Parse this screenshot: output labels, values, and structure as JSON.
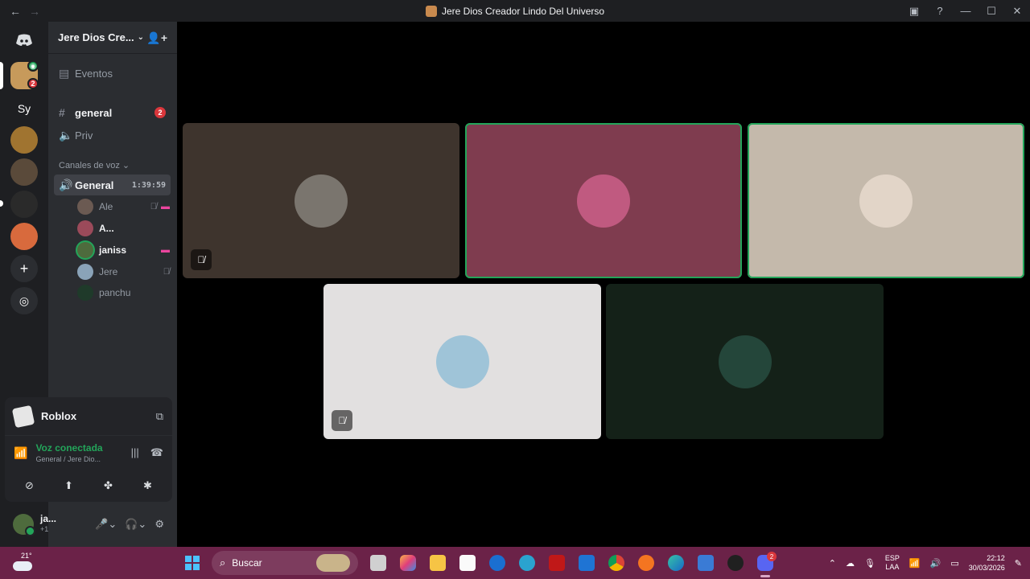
{
  "window": {
    "title": "Jere Dios Creador Lindo Del Universo"
  },
  "guild": {
    "name": "Jere Dios Cre..."
  },
  "rail": {
    "servers": [
      {
        "label": "",
        "badge": "2",
        "color": "#c79a5b"
      },
      {
        "label": "Sy",
        "badge": "",
        "color": "#2b2d31"
      },
      {
        "label": "",
        "badge": "",
        "color": "#a07430"
      },
      {
        "label": "",
        "badge": "",
        "color": "#5a4a3a"
      },
      {
        "label": "",
        "badge": "",
        "color": "#2a2a2a"
      },
      {
        "label": "",
        "badge": "",
        "color": "#d86a3d"
      }
    ]
  },
  "channels": {
    "events": "Eventos",
    "text": [
      {
        "name": "general",
        "badge": "2"
      },
      {
        "name": "Priv"
      }
    ],
    "voice_category": "Canales de voz",
    "voice": {
      "name": "General",
      "timer": "1:39:59"
    },
    "members": [
      {
        "name": "Ale",
        "muted": true,
        "streaming": true,
        "avatar_color": "#6b5a52"
      },
      {
        "name": "A...",
        "muted": false,
        "streaming": false,
        "avatar_color": "#9b4a5a"
      },
      {
        "name": "janiss",
        "muted": false,
        "streaming": true,
        "avatar_color": "#4e6b3d"
      },
      {
        "name": "Jere",
        "muted": true,
        "streaming": false,
        "avatar_color": "#8aa3b8"
      },
      {
        "name": "panchu",
        "muted": false,
        "streaming": false,
        "avatar_color": "#1f3a2a"
      }
    ]
  },
  "activity": {
    "name": "Roblox"
  },
  "voice_status": {
    "title": "Voz conectada",
    "subtitle": "General / Jere Dio..."
  },
  "user": {
    "name": "ja...",
    "status": "+1"
  },
  "tiles": [
    {
      "bg": "#3e342d",
      "avatar": "#7a756e",
      "speaking": false,
      "muted": true
    },
    {
      "bg": "#7f3c4f",
      "avatar": "#c05a80",
      "speaking": true,
      "muted": false
    },
    {
      "bg": "#c4b9ab",
      "avatar": "#e2d5c8",
      "speaking": true,
      "muted": false
    },
    {
      "bg": "#e2e0e0",
      "avatar": "#9fc4d8",
      "speaking": false,
      "muted": true
    },
    {
      "bg": "#142118",
      "avatar": "#24463a",
      "speaking": false,
      "muted": false
    }
  ],
  "taskbar": {
    "weather_temp": "21°",
    "search_placeholder": "Buscar",
    "discord_badge": "2",
    "lang": "ESP",
    "layout": "LAA",
    "time": "22:12",
    "date": "30/03/2026"
  }
}
